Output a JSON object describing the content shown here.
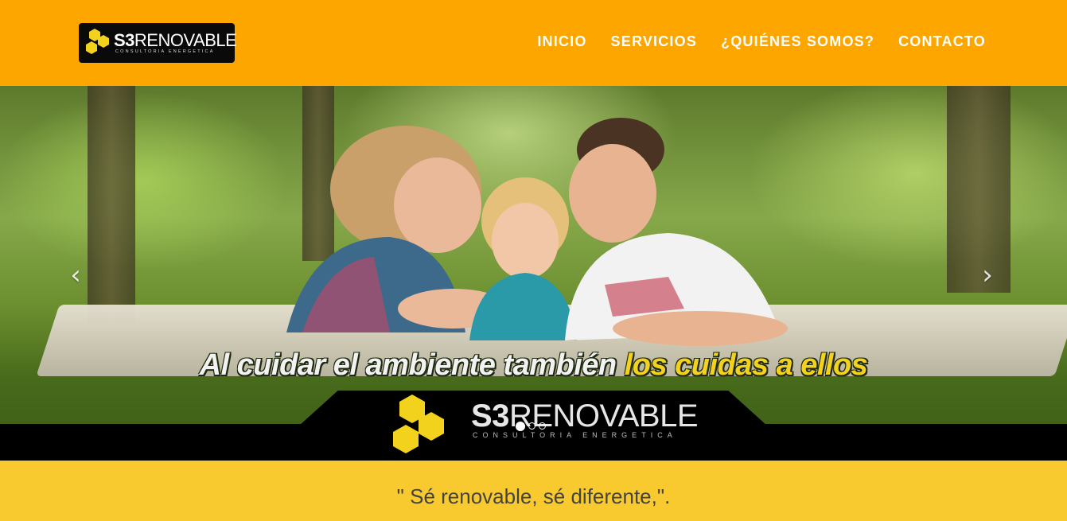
{
  "brand": {
    "logo_main": "S3",
    "logo_rest": "RENOVABLE",
    "logo_sub": "CONSULTORIA ENERGETICA",
    "colors": {
      "header": "#fda600",
      "quote_band": "#f8ca2f",
      "hex_yellow": "#f3d21d"
    }
  },
  "nav": {
    "items": [
      {
        "label": "INICIO"
      },
      {
        "label": "SERVICIOS"
      },
      {
        "label": "¿QUIÉNES SOMOS?"
      },
      {
        "label": "CONTACTO"
      }
    ]
  },
  "hero": {
    "tagline_white": "Al cuidar el ambiente también",
    "tagline_yellow": "los cuidas a ellos",
    "logo_main": "S3",
    "logo_rest": "RENOVABLE",
    "logo_sub": "CONSULTORIA ENERGETICA",
    "prev_icon": "chevron-left-icon",
    "next_icon": "chevron-right-icon",
    "slides_total": 3,
    "active_slide": 1
  },
  "quote": {
    "text": "\" Sé renovable, sé diferente,\"."
  }
}
